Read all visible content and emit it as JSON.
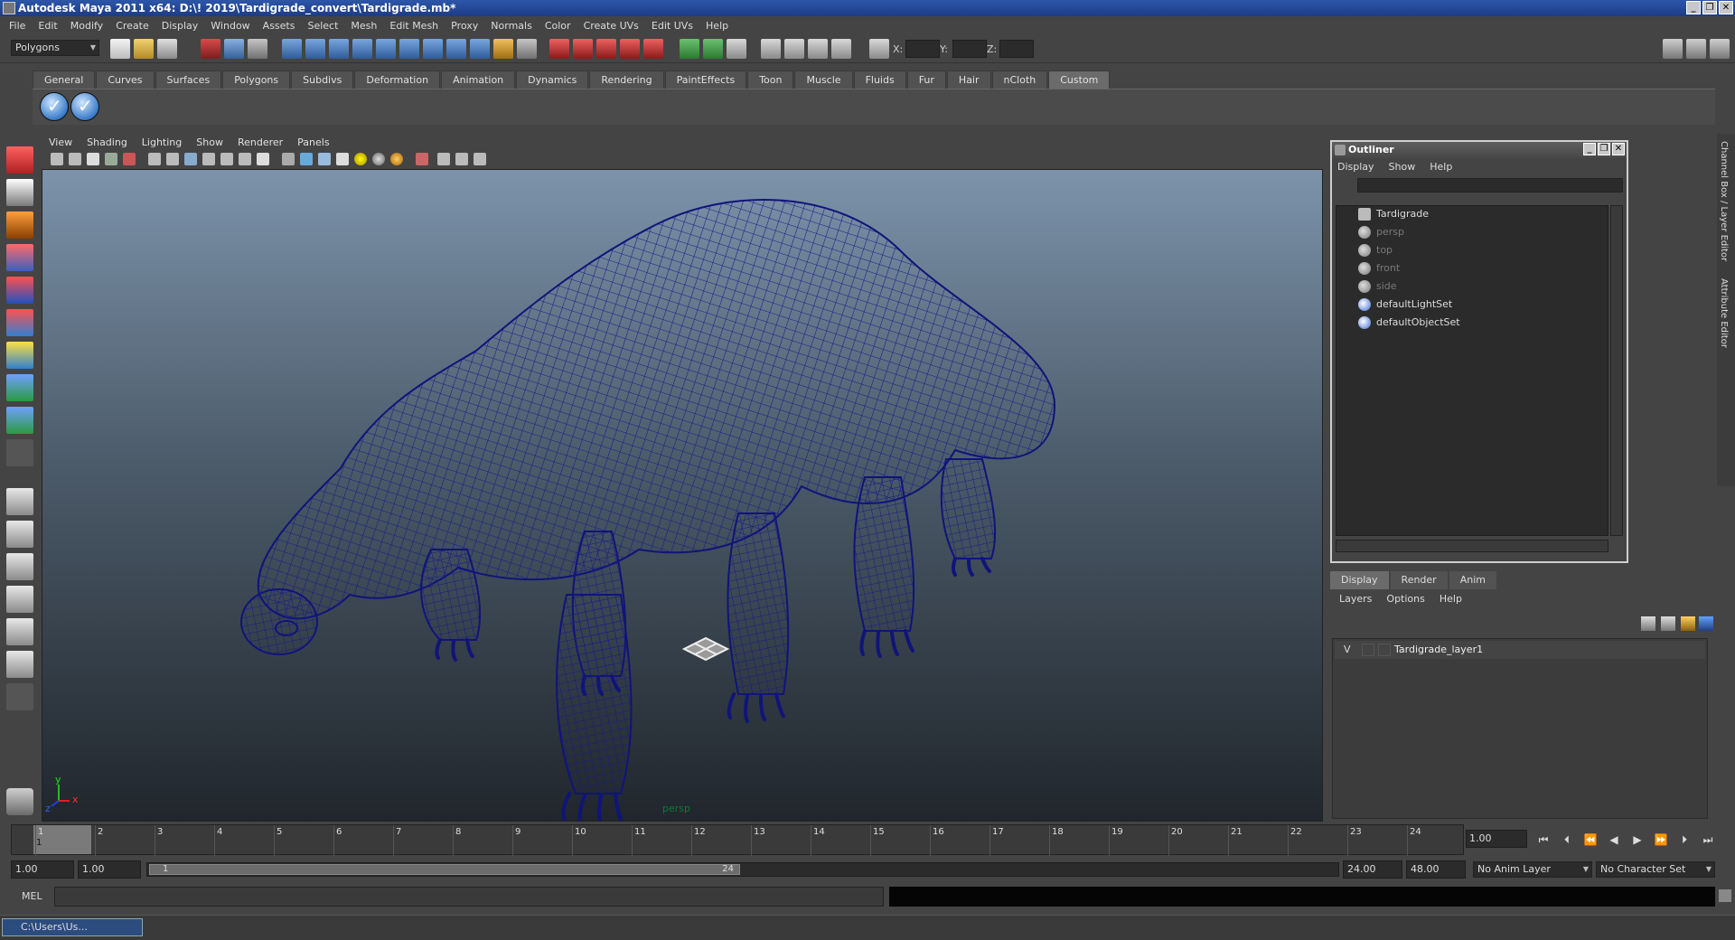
{
  "window": {
    "title": "Autodesk Maya 2011 x64: D:\\! 2019\\Tardigrade_convert\\Tardigrade.mb*",
    "min": "_",
    "max": "❐",
    "close": "✕"
  },
  "menubar": [
    "File",
    "Edit",
    "Modify",
    "Create",
    "Display",
    "Window",
    "Assets",
    "Select",
    "Mesh",
    "Edit Mesh",
    "Proxy",
    "Normals",
    "Color",
    "Create UVs",
    "Edit UVs",
    "Help"
  ],
  "statusline": {
    "mode_menu": "Polygons",
    "x_label": "X:",
    "y_label": "Y:",
    "z_label": "Z:"
  },
  "shelf": {
    "tabs": [
      "General",
      "Curves",
      "Surfaces",
      "Polygons",
      "Subdivs",
      "Deformation",
      "Animation",
      "Dynamics",
      "Rendering",
      "PaintEffects",
      "Toon",
      "Muscle",
      "Fluids",
      "Fur",
      "Hair",
      "nCloth",
      "Custom"
    ],
    "active_tab": "Custom"
  },
  "viewport": {
    "menu": [
      "View",
      "Shading",
      "Lighting",
      "Show",
      "Renderer",
      "Panels"
    ],
    "camera_label": "persp",
    "axis_x": "x",
    "axis_y": "y",
    "axis_z": "z"
  },
  "outliner": {
    "title": "Outliner",
    "menu": [
      "Display",
      "Show",
      "Help"
    ],
    "items": [
      {
        "label": "Tardigrade",
        "dim": false
      },
      {
        "label": "persp",
        "dim": true
      },
      {
        "label": "top",
        "dim": true
      },
      {
        "label": "front",
        "dim": true
      },
      {
        "label": "side",
        "dim": true
      },
      {
        "label": "defaultLightSet",
        "dim": false
      },
      {
        "label": "defaultObjectSet",
        "dim": false
      }
    ]
  },
  "layer_editor": {
    "tabs": [
      "Display",
      "Render",
      "Anim"
    ],
    "active_tab": "Display",
    "menu": [
      "Layers",
      "Options",
      "Help"
    ],
    "layer": {
      "visible": "V",
      "name": "Tardigrade_layer1"
    }
  },
  "side_tabs": [
    "Channel Box / Layer Editor",
    "Attribute Editor"
  ],
  "timeline": {
    "ticks": [
      "1",
      "2",
      "3",
      "4",
      "5",
      "6",
      "7",
      "8",
      "9",
      "10",
      "11",
      "12",
      "13",
      "14",
      "15",
      "16",
      "17",
      "18",
      "19",
      "20",
      "21",
      "22",
      "23",
      "24"
    ],
    "current_frame": "1",
    "current_time": "1.00"
  },
  "range": {
    "start": "1.00",
    "playback_start": "1.00",
    "slider_start": "1",
    "slider_end": "24",
    "playback_end": "24.00",
    "end": "48.00",
    "anim_layer": "No Anim Layer",
    "character_set": "No Character Set"
  },
  "command_line": {
    "label": "MEL"
  },
  "taskbar": {
    "item": "C:\\Users\\Us..."
  }
}
